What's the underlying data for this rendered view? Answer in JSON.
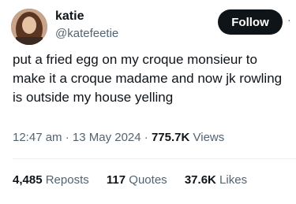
{
  "author": {
    "name": "katie",
    "handle": "@katefeetie"
  },
  "follow_label": "Follow",
  "more_glyph": "·",
  "tweet": {
    "text": "put a fried egg on my croque monsieur to make it a croque madame and now jk rowling is outside my house yelling"
  },
  "meta": {
    "time": "12:47 am",
    "sep1": "·",
    "date": "13 May 2024",
    "sep2": "·",
    "views_count": "775.7K",
    "views_label": "Views"
  },
  "stats": {
    "reposts_count": "4,485",
    "reposts_label": "Reposts",
    "quotes_count": "117",
    "quotes_label": "Quotes",
    "likes_count": "37.6K",
    "likes_label": "Likes"
  },
  "colors": {
    "text_primary": "#0f1419",
    "text_secondary": "#536471",
    "follow_bg": "#0f1419",
    "divider": "#eff3f4"
  }
}
